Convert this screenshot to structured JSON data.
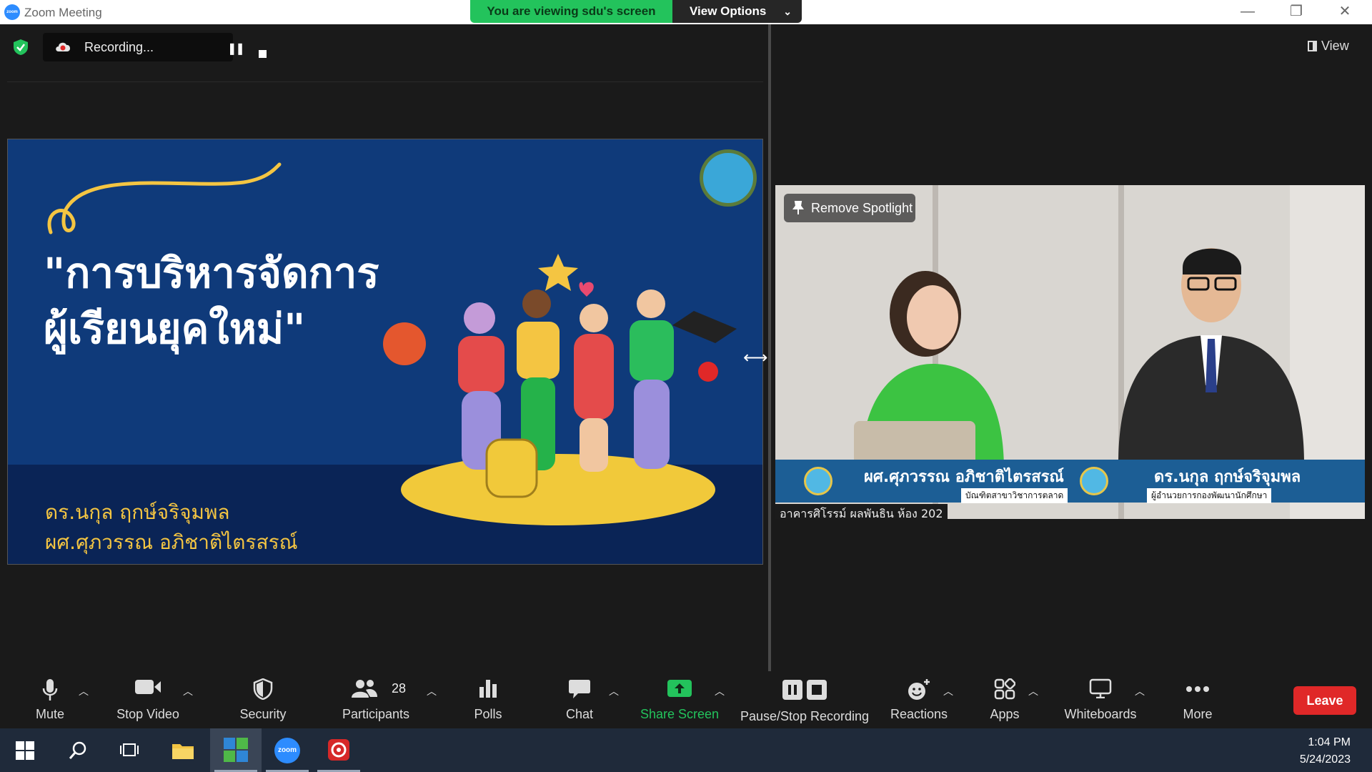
{
  "window": {
    "title": "Zoom Meeting",
    "viewing_banner": "You are viewing sdu's screen",
    "view_options": "View Options",
    "minimize": "—",
    "restore": "❐",
    "close": "✕"
  },
  "meeting": {
    "recording_label": "Recording...",
    "view_label": "View"
  },
  "slide": {
    "title_line1": "\"การบริหารจัดการ",
    "title_line2": "ผู้เรียนยุคใหม่\"",
    "name1": "ดร.นกุล ฤกษ์จริจุมพล",
    "name2": "ผศ.ศุภวรรณ อภิชาติไตรสรณ์"
  },
  "spotlight": {
    "remove_label": "Remove Spotlight",
    "left_name": "ผศ.ศุภวรรณ อภิชาติไตรสรณ์",
    "left_sub": "บัณฑิตสาขาวิชาการตลาด",
    "right_name": "ดร.นกุล ฤกษ์จริจุมพล",
    "right_sub": "ผู้อำนวยการกองพัฒนานักศึกษา",
    "room": "อาคารศิโรรม์ ผลพันธิน ห้อง 202"
  },
  "toolbar": {
    "mute": "Mute",
    "stop_video": "Stop Video",
    "security": "Security",
    "participants": "Participants",
    "participants_count": "28",
    "polls": "Polls",
    "chat": "Chat",
    "share_screen": "Share Screen",
    "pause_stop_recording": "Pause/Stop Recording",
    "reactions": "Reactions",
    "apps": "Apps",
    "whiteboards": "Whiteboards",
    "more": "More",
    "leave": "Leave"
  },
  "taskbar": {
    "time": "1:04 PM",
    "date": "5/24/2023",
    "zoom_app": "zoom"
  },
  "colors": {
    "accent_green": "#23c35c",
    "leave_red": "#e02828",
    "slide_blue": "#0f3a7a",
    "slide_gold": "#f4c542"
  }
}
